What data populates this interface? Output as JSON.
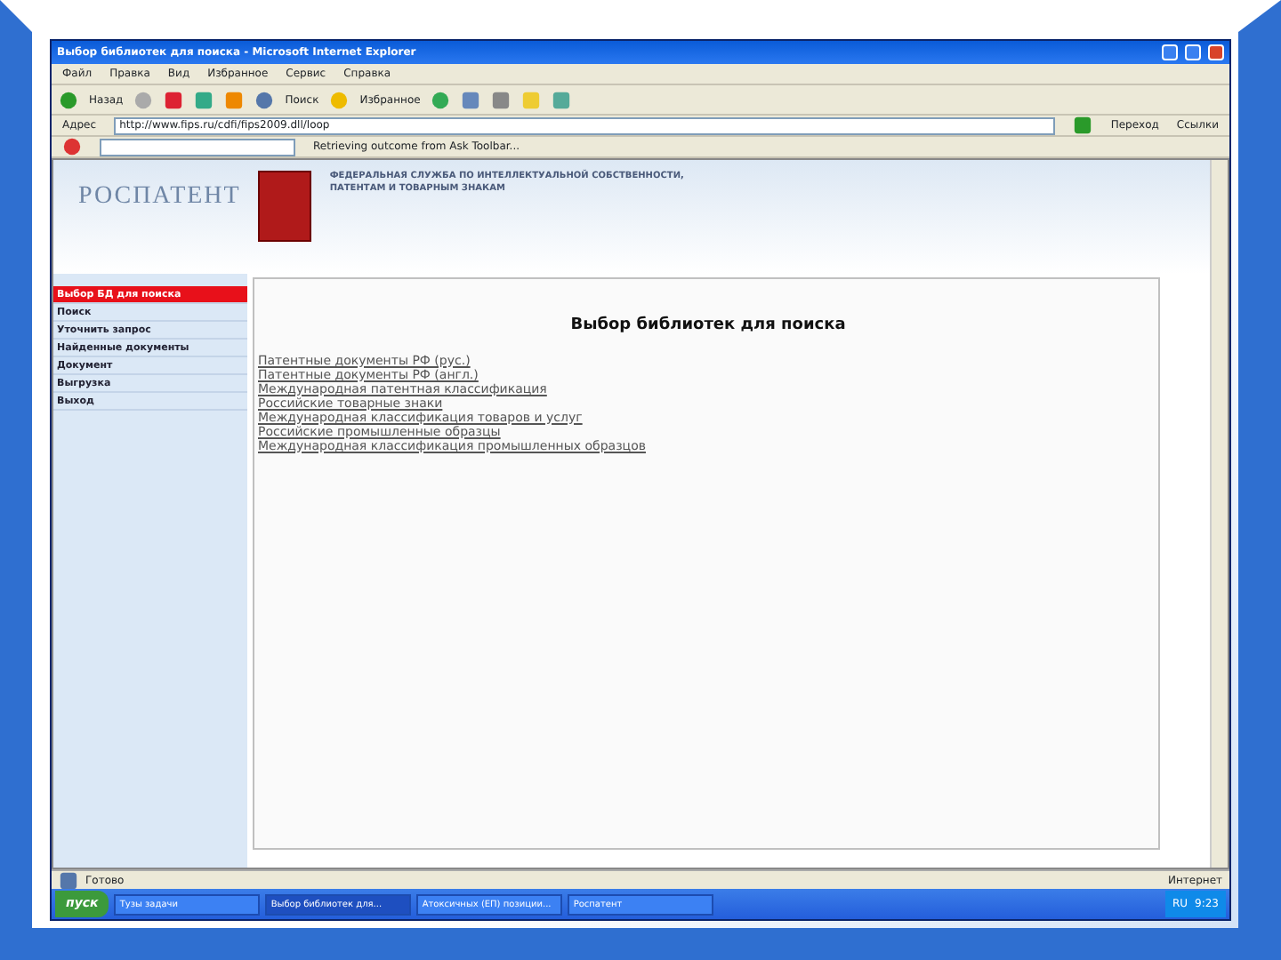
{
  "window": {
    "title": "Выбор библиотек для поиска - Microsoft Internet Explorer"
  },
  "menu": [
    "Файл",
    "Правка",
    "Вид",
    "Избранное",
    "Сервис",
    "Справка"
  ],
  "toolbar": {
    "back": "Назад",
    "search": "Поиск",
    "favorites": "Избранное"
  },
  "address_bar": {
    "label": "Адрес",
    "value": "http://www.fips.ru/cdfi/fips2009.dll/loop",
    "go": "Переход",
    "links": "Ссылки"
  },
  "ask_toolbar": {
    "status": "Retrieving outcome from Ask Toolbar..."
  },
  "site_header": {
    "logo": "РОСПАТЕНТ",
    "org_line_1": "ФЕДЕРАЛЬНАЯ СЛУЖБА ПО ИНТЕЛЛЕКТУАЛЬНОЙ СОБСТВЕННОСТИ,",
    "org_line_2": "ПАТЕНТАМ И ТОВАРНЫМ ЗНАКАМ"
  },
  "sidebar": {
    "items": [
      {
        "label": "Выбор БД для поиска",
        "selected": true
      },
      {
        "label": "Поиск",
        "selected": false
      },
      {
        "label": "Уточнить запрос",
        "selected": false
      },
      {
        "label": "Найденные документы",
        "selected": false
      },
      {
        "label": "Документ",
        "selected": false
      },
      {
        "label": "Выгрузка",
        "selected": false
      },
      {
        "label": "Выход",
        "selected": false
      }
    ]
  },
  "main": {
    "heading": "Выбор библиотек для поиска",
    "libraries": [
      "Патентные документы РФ (рус.)",
      "Патентные документы РФ (англ.)",
      "Международная патентная классификация",
      "Российские товарные знаки",
      "Международная классификация товаров и услуг",
      "Российские промышленные образцы",
      "Международная классификация промышленных образцов"
    ]
  },
  "status_bar": {
    "text": "Готово",
    "zone": "Интернет"
  },
  "taskbar": {
    "start": "пуск",
    "tasks": [
      {
        "label": "Тузы задачи",
        "selected": false
      },
      {
        "label": "Выбор библиотек для...",
        "selected": true
      },
      {
        "label": "Атоксичных (ЕП) позиции...",
        "selected": false
      },
      {
        "label": "Роспатент",
        "selected": false
      }
    ],
    "lang": "RU",
    "clock": "9:23"
  }
}
